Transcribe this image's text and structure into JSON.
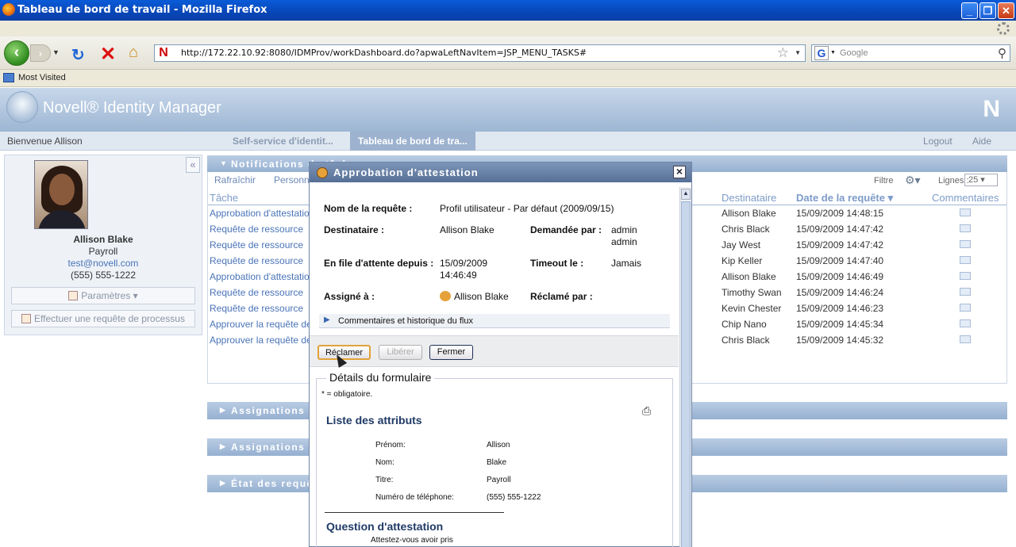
{
  "window": {
    "title": "Tableau de bord de travail - Mozilla Firefox",
    "controls": [
      "_",
      "❐",
      "✕"
    ]
  },
  "browser": {
    "url": "http://172.22.10.92:8080/IDMProv/workDashboard.do?apwaLeftNavItem=JSP_MENU_TASKS#",
    "search_placeholder": "Google",
    "bookmark": "Most Visited"
  },
  "app": {
    "brand": "Novell® Identity Manager",
    "logo_letter": "N",
    "welcome": "Bienvenue Allison",
    "tabs": [
      {
        "label": "Self-service d'identit...",
        "active": false
      },
      {
        "label": "Tableau de bord de tra...",
        "active": true
      }
    ],
    "top_links": [
      "Logout",
      "Aide"
    ]
  },
  "profile": {
    "name": "Allison Blake",
    "department": "Payroll",
    "email": "test@novell.com",
    "phone": "(555) 555-1222",
    "settings_button": "Paramètres",
    "process_button": "Effectuer une requête de processus"
  },
  "notifications": {
    "header": "Notifications de tâches",
    "actions": [
      "Rafraîchir",
      "Personnaliser"
    ],
    "filter_label": "Filtre",
    "lines_label": "Lignes :",
    "lines_value": "25",
    "columns": {
      "task": "Tâche",
      "recipient": "Destinataire",
      "date": "Date de la requête",
      "comments": "Commentaires"
    },
    "rows": [
      {
        "task": "Approbation d'attestation",
        "recipient": "Allison Blake",
        "date": "15/09/2009 14:48:15"
      },
      {
        "task": "Requête de ressource",
        "recipient": "Chris Black",
        "date": "15/09/2009 14:47:42"
      },
      {
        "task": "Requête de ressource",
        "recipient": "Jay West",
        "date": "15/09/2009 14:47:42"
      },
      {
        "task": "Requête de ressource",
        "recipient": "Kip Keller",
        "date": "15/09/2009 14:47:40"
      },
      {
        "task": "Approbation d'attestation",
        "recipient": "Allison Blake",
        "date": "15/09/2009 14:46:49"
      },
      {
        "task": "Requête de ressource",
        "recipient": "Timothy Swan",
        "date": "15/09/2009 14:46:24"
      },
      {
        "task": "Requête de ressource",
        "recipient": "Kevin Chester",
        "date": "15/09/2009 14:46:23"
      },
      {
        "task": "Approuver la requête de",
        "recipient": "Chip Nano",
        "date": "15/09/2009 14:45:34"
      },
      {
        "task": "Approuver la requête de",
        "recipient": "Chris Black",
        "date": "15/09/2009 14:45:32"
      }
    ]
  },
  "portlets": [
    "Assignations",
    "Assignations",
    "État des requêtes"
  ],
  "modal": {
    "title": "Approbation d'attestation",
    "request_name_label": "Nom de la requête :",
    "request_name": "Profil utilisateur - Par défaut (2009/09/15)",
    "recipient_label": "Destinataire :",
    "recipient": "Allison Blake",
    "requested_by_label": "Demandée par :",
    "requested_by_1": "admin",
    "requested_by_2": "admin",
    "queued_label": "En file d'attente depuis :",
    "queued_date": "15/09/2009",
    "queued_time": "14:46:49",
    "timeout_label": "Timeout le :",
    "timeout": "Jamais",
    "assigned_label": "Assigné à :",
    "assigned": "Allison Blake",
    "claimed_label": "Réclamé par :",
    "history": "Commentaires et historique du flux",
    "buttons": {
      "claim": "Réclamer",
      "release": "Libérer",
      "close": "Fermer"
    },
    "form": {
      "legend": "Détails du formulaire",
      "required": "* = obligatoire.",
      "attr_section": "Liste des attributs",
      "attributes": [
        {
          "name": "Prénom:",
          "value": "Allison"
        },
        {
          "name": "Nom:",
          "value": "Blake"
        },
        {
          "name": "Titre:",
          "value": "Payroll"
        },
        {
          "name": "Numéro de téléphone:",
          "value": "(555) 555-1222"
        }
      ],
      "question_section": "Question d'attestation",
      "question_text": "Attestez-vous avoir pris"
    }
  }
}
